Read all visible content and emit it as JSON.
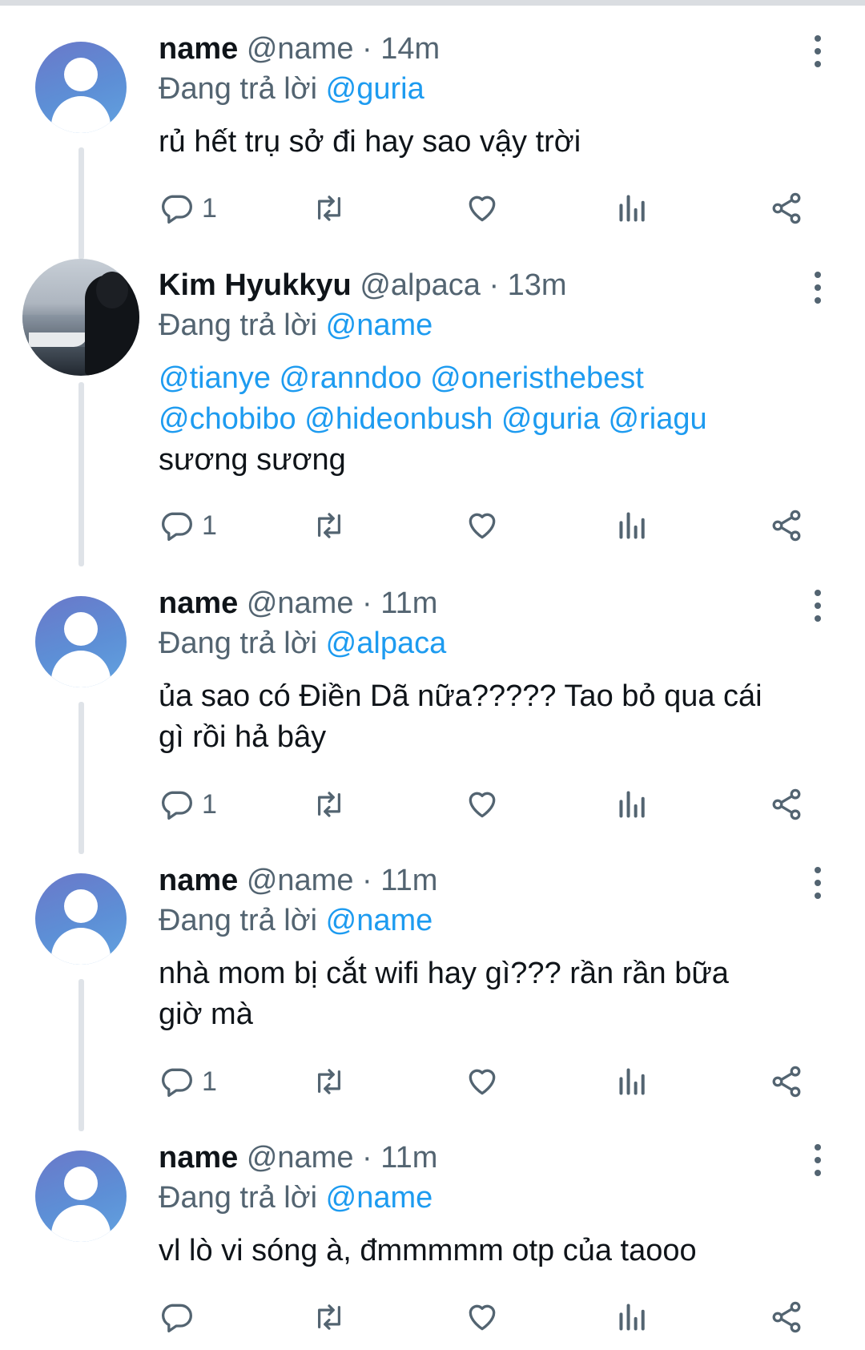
{
  "colors": {
    "text": "#0f1419",
    "muted": "#536471",
    "mention": "#1d9bf0",
    "thread_line": "#dfe3e8"
  },
  "replying_prefix": "Đang trả lời",
  "icons": [
    "reply-icon",
    "retweet-icon",
    "like-icon",
    "views-icon",
    "share-icon",
    "more-icon"
  ],
  "tweets": [
    {
      "name": "name",
      "handle": "@name",
      "dot": "·",
      "time": "14m",
      "replying_to": "@guria",
      "lines": [
        "rủ hết trụ sở đi hay sao vậy trời"
      ],
      "reply_count": "1",
      "avatar": "default"
    },
    {
      "name": "Kim Hyukkyu",
      "handle": "@alpaca",
      "dot": "·",
      "time": "13m",
      "replying_to": "@name",
      "mentions": [
        "@tianye @ranndoo @oneristhebest",
        "@chobibo @hideonbush @guria @riagu"
      ],
      "lines": [
        "sương sương"
      ],
      "reply_count": "1",
      "avatar": "photo"
    },
    {
      "name": "name",
      "handle": "@name",
      "dot": "·",
      "time": "11m",
      "replying_to": "@alpaca",
      "lines": [
        "ủa sao có Điền Dã nữa????? Tao bỏ qua cái",
        "gì rồi hả bây"
      ],
      "reply_count": "1",
      "avatar": "default"
    },
    {
      "name": "name",
      "handle": "@name",
      "dot": "·",
      "time": "11m",
      "replying_to": "@name",
      "lines": [
        "nhà mom bị cắt wifi hay gì??? rần rần bữa",
        "giờ mà"
      ],
      "reply_count": "1",
      "avatar": "default"
    },
    {
      "name": "name",
      "handle": "@name",
      "dot": "·",
      "time": "11m",
      "replying_to": "@name",
      "lines": [
        "vl lò vi sóng à, đmmmmm otp của taooo"
      ],
      "reply_count": "",
      "avatar": "default"
    }
  ]
}
